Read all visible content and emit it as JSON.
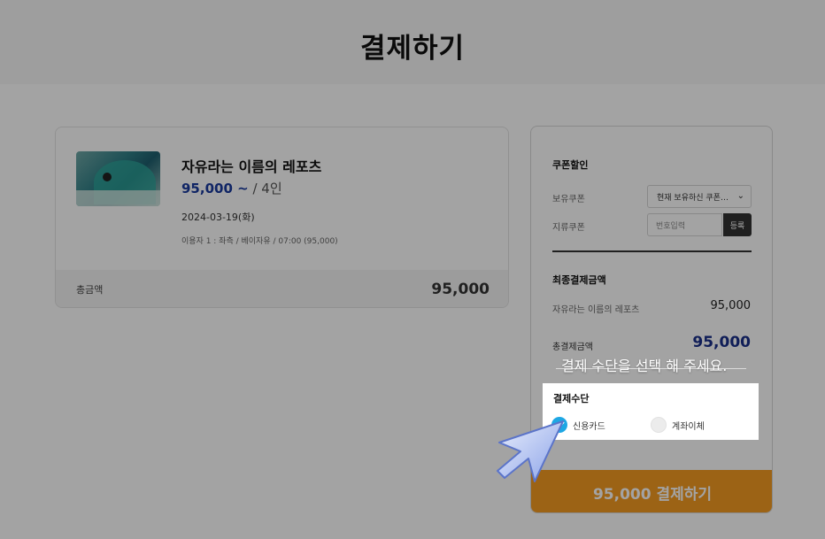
{
  "header": {
    "title": "결제하기"
  },
  "product": {
    "title": "자유라는 이름의 레포츠",
    "price": "95,000 ~",
    "per_person": "/ 4인",
    "date": "2024-03-19(화)",
    "detail": "이용자 1 : 좌측 / 베이자유 / 07:00 (95,000)",
    "total_label": "총금액",
    "total_value": "95,000"
  },
  "coupon": {
    "heading": "쿠폰할인",
    "owned_label": "보유쿠폰",
    "owned_select": "현재 보유하신 쿠폰…",
    "paper_label": "지류쿠폰",
    "code_placeholder": "번호입력",
    "register_label": "등록"
  },
  "summary": {
    "heading": "최종결제금액",
    "item_label": "자유라는 이름의 레포츠",
    "item_value": "95,000",
    "total_label": "총결제금액",
    "total_value": "95,000"
  },
  "payment_method": {
    "heading": "결제수단",
    "options": [
      {
        "label": "신용카드",
        "selected": true
      },
      {
        "label": "계좌이체",
        "selected": false
      }
    ]
  },
  "pay_button": {
    "label": "95,000 결제하기"
  },
  "tooltip": {
    "text": "결제 수단을 선택 해 주세요."
  },
  "colors": {
    "accent_orange": "#f59b22",
    "price_blue": "#1a3a9e",
    "radio_selected": "#1ea7e4"
  },
  "icons": {
    "select_arrow": "chevron-down-icon",
    "tutorial_pointer": "cursor-pointer-icon",
    "radio_check": "check-icon"
  }
}
